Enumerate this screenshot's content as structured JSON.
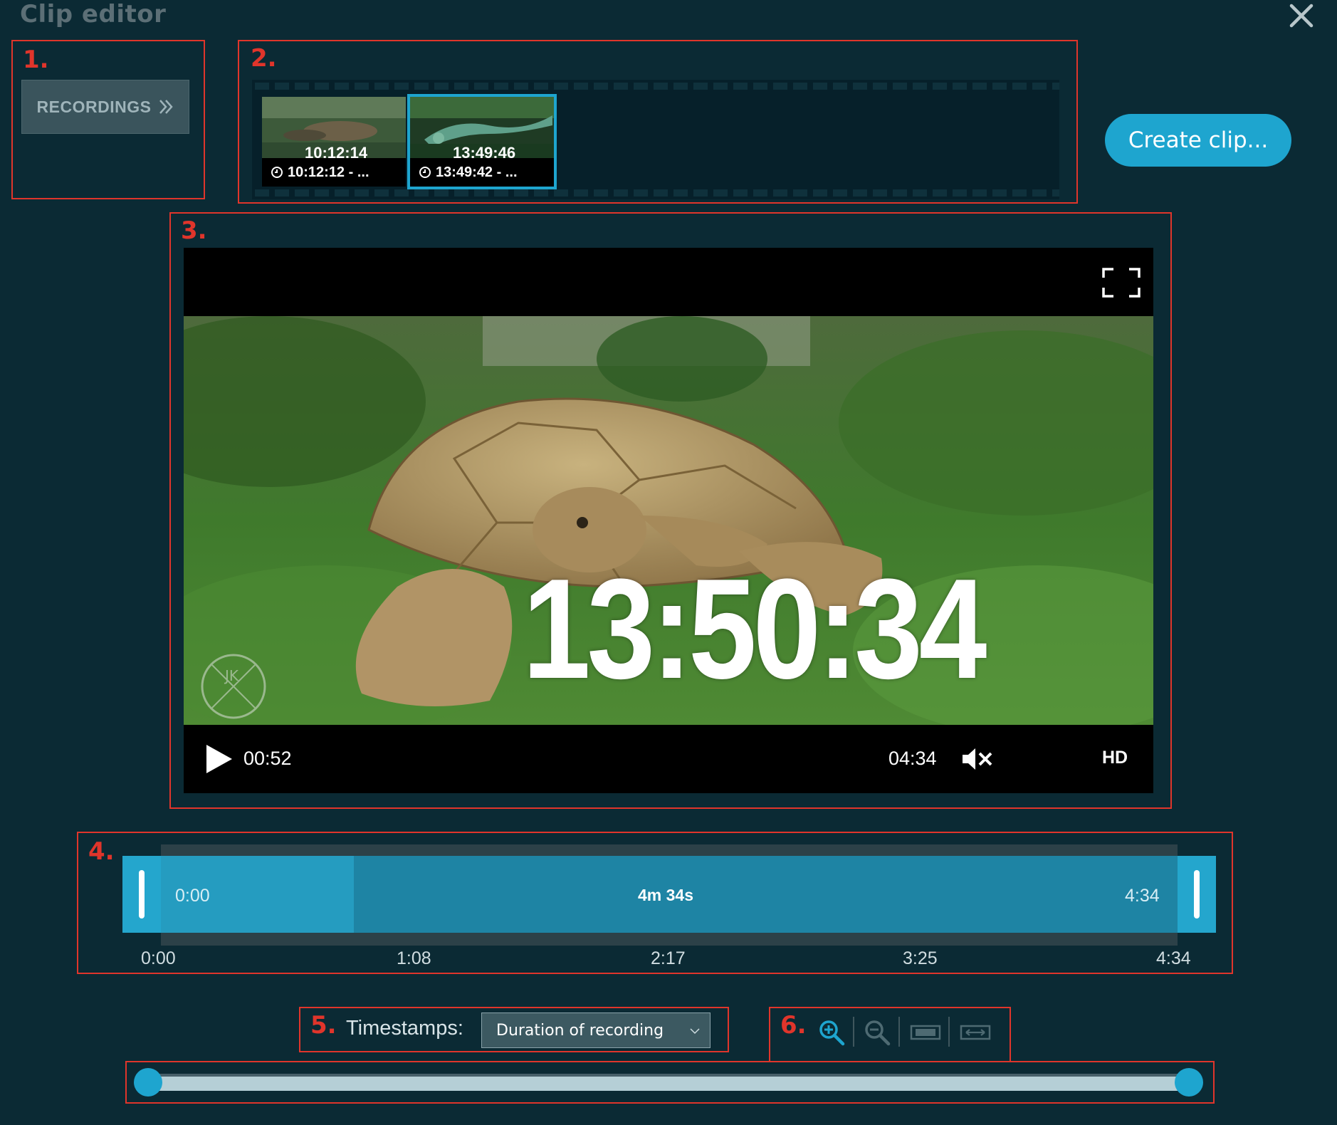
{
  "header": {
    "title": "Clip editor"
  },
  "annotations": [
    "1.",
    "2.",
    "3.",
    "4.",
    "5.",
    "6."
  ],
  "recordings": {
    "label": "RECORDINGS"
  },
  "filmstrip": {
    "thumbnails": [
      {
        "label": "10:12:12 - ...",
        "overlay": "10:12:14",
        "active": false
      },
      {
        "label": "13:49:42 - ...",
        "overlay": "13:49:46",
        "active": true
      }
    ]
  },
  "actions": {
    "create_clip": "Create clip..."
  },
  "player": {
    "timestamp_overlay": "13:50:34",
    "watermark": "JK",
    "current_time": "00:52",
    "duration": "04:34",
    "quality": "HD"
  },
  "timeline": {
    "start": "0:00",
    "length": "4m 34s",
    "end": "4:34",
    "played_fraction": 0.19,
    "ticks": [
      "0:00",
      "1:08",
      "2:17",
      "3:25",
      "4:34"
    ]
  },
  "timestamps": {
    "label": "Timestamps:",
    "selected": "Duration of recording"
  },
  "colors": {
    "accent": "#1ea5cf",
    "background": "#0b2a34",
    "annotation": "#e0352b"
  }
}
